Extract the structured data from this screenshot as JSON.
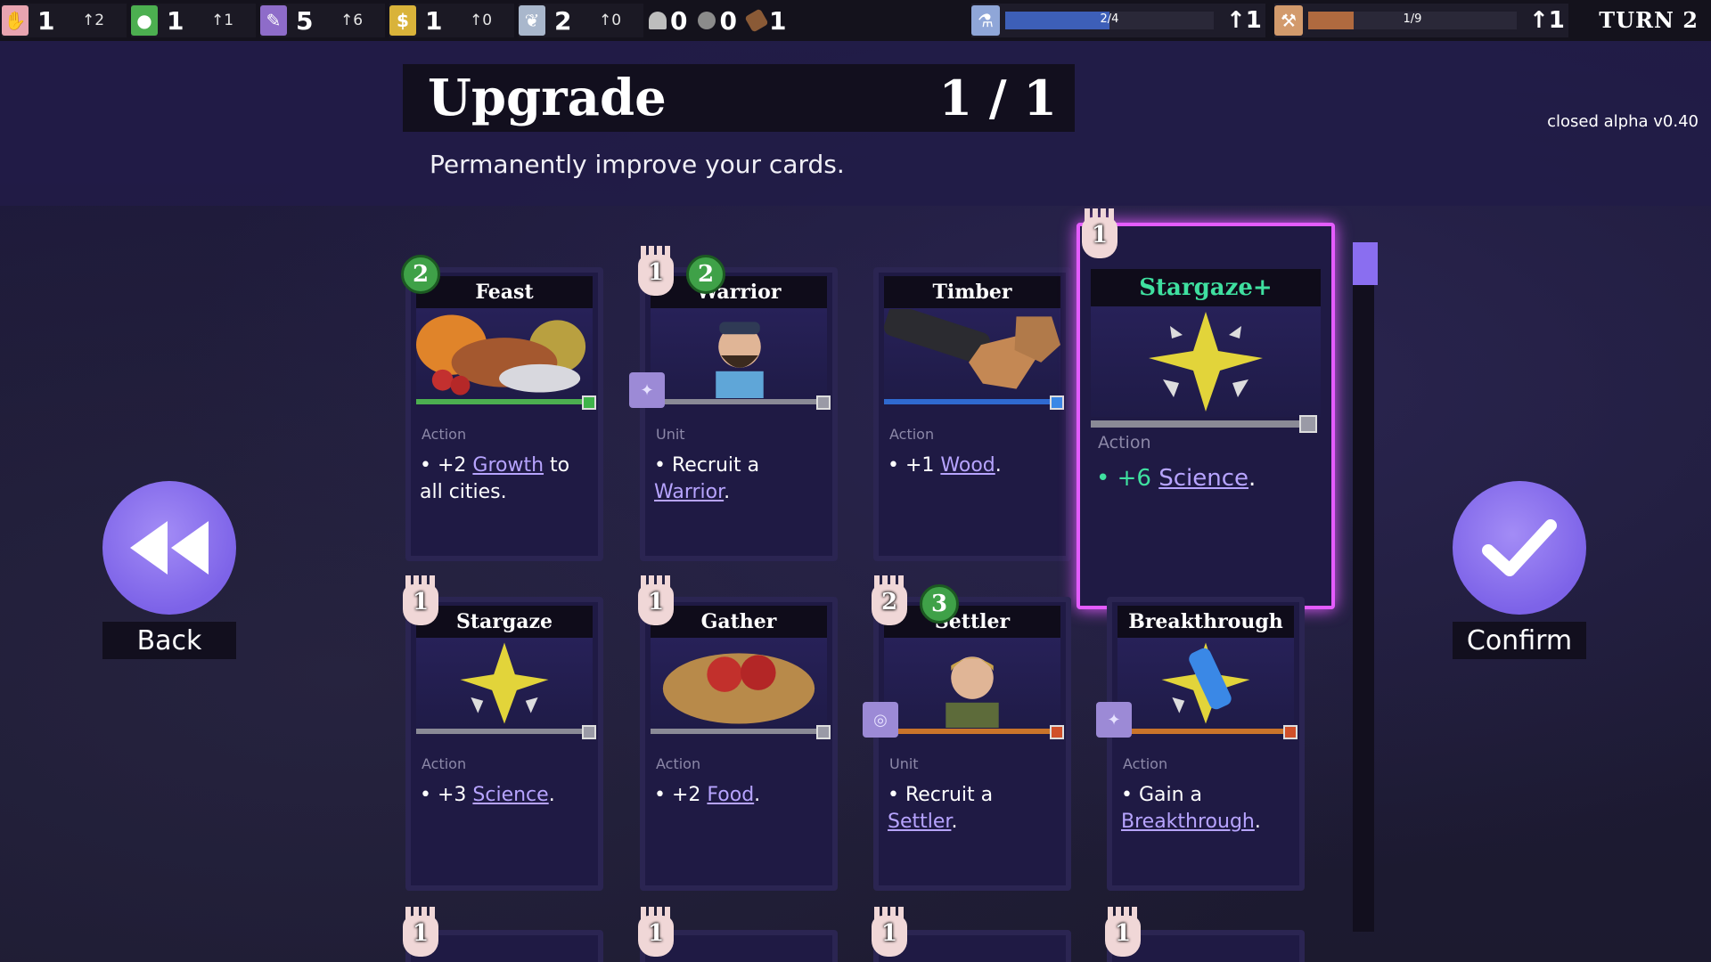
{
  "topbar": {
    "resources": [
      {
        "icon": "hand-icon",
        "value": "1",
        "gain": "↑2",
        "color": "#e8a4b0"
      },
      {
        "icon": "apple-icon",
        "value": "1",
        "gain": "↑1",
        "color": "#4caf50"
      },
      {
        "icon": "feather-icon",
        "value": "5",
        "gain": "↑6",
        "color": "#8e6cc9"
      },
      {
        "icon": "money-bag-icon",
        "value": "1",
        "gain": "↑0",
        "color": "#d9b33a"
      },
      {
        "icon": "dove-icon",
        "value": "2",
        "gain": "↑0",
        "color": "#a9b7cc"
      }
    ],
    "minor": [
      {
        "icon": "horse-icon",
        "value": "0"
      },
      {
        "icon": "stone-icon",
        "value": "0"
      },
      {
        "icon": "wood-icon",
        "value": "1"
      }
    ],
    "science": {
      "icon": "flask-icon",
      "progress_text": "2/4",
      "progress": 0.5,
      "gain": "↑1",
      "color": "#3d5fb8"
    },
    "production": {
      "icon": "hammer-icon",
      "progress_text": "1/9",
      "progress": 0.22,
      "gain": "↑1",
      "color": "#b06a3f"
    },
    "turn": "TURN 2"
  },
  "header": {
    "title": "Upgrade",
    "counter": "1 / 1",
    "subtitle": "Permanently improve your cards.",
    "version": "closed alpha v0.40"
  },
  "buttons": {
    "back": "Back",
    "confirm": "Confirm"
  },
  "cards": [
    {
      "name": "Feast",
      "type": "Action",
      "apple": "2",
      "desc_pre": "• +2 ",
      "kw": "Growth",
      "desc_post": " to all cities.",
      "rarity": "#4caf50"
    },
    {
      "name": "Warrior",
      "type": "Unit",
      "hand": "1",
      "apple": "2",
      "desc_pre": "• Recruit a ",
      "kw": "Warrior",
      "desc_post": ".",
      "rarity": "#8a8a96"
    },
    {
      "name": "Timber",
      "type": "Action",
      "desc_pre": "• +1 ",
      "kw": "Wood",
      "desc_post": ".",
      "rarity": "#2f6ad0"
    },
    {
      "name": "Stargaze+",
      "type": "Action",
      "hand": "1",
      "desc_pre": "• +6 ",
      "kw": "Science",
      "desc_post": ".",
      "rarity": "#8a8a96"
    },
    {
      "name": "Stargaze",
      "type": "Action",
      "hand": "1",
      "desc_pre": "• +3 ",
      "kw": "Science",
      "desc_post": ".",
      "rarity": "#8a8a96"
    },
    {
      "name": "Gather",
      "type": "Action",
      "hand": "1",
      "desc_pre": "• +2 ",
      "kw": "Food",
      "desc_post": ".",
      "rarity": "#8a8a96"
    },
    {
      "name": "Settler",
      "type": "Unit",
      "hand": "2",
      "apple": "3",
      "desc_pre": "• Recruit a ",
      "kw": "Settler",
      "desc_post": ".",
      "rarity": "#c9742a"
    },
    {
      "name": "Breakthrough",
      "type": "Action",
      "desc_pre": "• Gain a ",
      "kw": "Breakthrough",
      "desc_post": ".",
      "rarity": "#c9742a"
    }
  ],
  "row3_hands": [
    "1",
    "1",
    "1",
    "1"
  ],
  "colors": {
    "accent": "#8a6ef0",
    "selected_glow": "#e45cff",
    "stargaze_plus_name": "#3fe0a0"
  }
}
